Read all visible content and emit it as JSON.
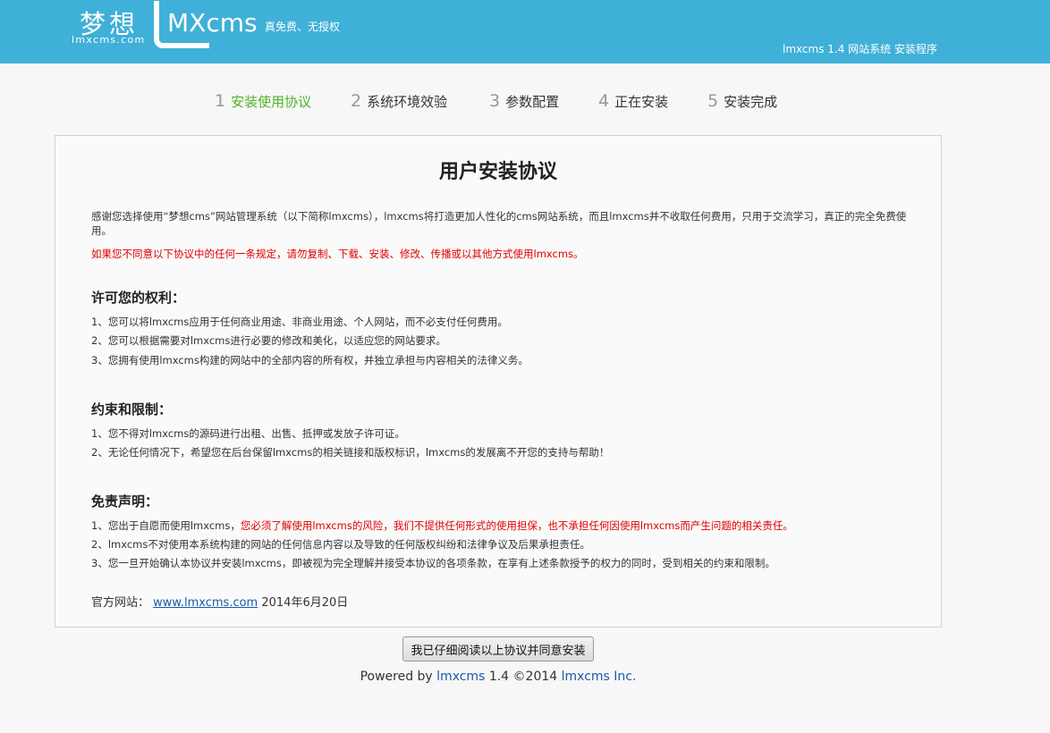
{
  "header": {
    "logo_cn": "梦想",
    "logo_en": "lmxcms.com",
    "logo_mx": "MXcms",
    "slogan": "真免费、无授权",
    "subtitle": "lmxcms 1.4 网站系统 安装程序"
  },
  "steps": [
    {
      "num": "1",
      "label": "安装使用协议",
      "active": true
    },
    {
      "num": "2",
      "label": "系统环境效验",
      "active": false
    },
    {
      "num": "3",
      "label": "参数配置",
      "active": false
    },
    {
      "num": "4",
      "label": "正在安装",
      "active": false
    },
    {
      "num": "5",
      "label": "安装完成",
      "active": false
    }
  ],
  "agreement": {
    "title": "用户安装协议",
    "intro": "感谢您选择使用“梦想cms”网站管理系统（以下简称lmxcms），lmxcms将打造更加人性化的cms网站系统，而且lmxcms并不收取任何费用，只用于交流学习，真正的完全免费使用。",
    "warning": "如果您不同意以下协议中的任何一条规定，请勿复制、下载、安装、修改、传播或以其他方式使用lmxcms。",
    "rights_title": "许可您的权利：",
    "rights": [
      "1、您可以将lmxcms应用于任何商业用途、非商业用途、个人网站，而不必支付任何费用。",
      "2、您可以根据需要对lmxcms进行必要的修改和美化，以适应您的网站要求。",
      "3、您拥有使用lmxcms构建的网站中的全部内容的所有权，并独立承担与内容相关的法律义务。"
    ],
    "limits_title": "约束和限制：",
    "limits": [
      "1、您不得对lmxcms的源码进行出租、出售、抵押或发放子许可证。",
      "2、无论任何情况下，希望您在后台保留lmxcms的相关链接和版权标识，lmxcms的发展离不开您的支持与帮助！"
    ],
    "disclaimer_title": "免责声明：",
    "disclaimer_1_prefix": "1、您出于自愿而使用lmxcms，",
    "disclaimer_1_red": "您必须了解使用lmxcms的风险，我们不提供任何形式的使用担保，也不承担任何因使用lmxcms而产生问题的相关责任。",
    "disclaimer_2": "2、lmxcms不对使用本系统构建的网站的任何信息内容以及导致的任何版权纠纷和法律争议及后果承担责任。",
    "disclaimer_3": "3、您一旦开始确认本协议并安装lmxcms，即被视为完全理解并接受本协议的各项条款，在享有上述条款授予的权力的同时，受到相关的约束和限制。",
    "website_label": "官方网站：",
    "website_link": "www.lmxcms.com",
    "date": "2014年6月20日"
  },
  "agree_button": "我已仔细阅读以上协议并同意安装",
  "footer": {
    "prefix": "Powered by ",
    "product": "lmxcms",
    "middle": " 1.4 ©2014 ",
    "company": "lmxcms Inc."
  },
  "colors": {
    "header_bg": "#3fb0d8",
    "active_step": "#52b22b",
    "warning_red": "#e00000",
    "link_blue": "#1a5aa8"
  }
}
